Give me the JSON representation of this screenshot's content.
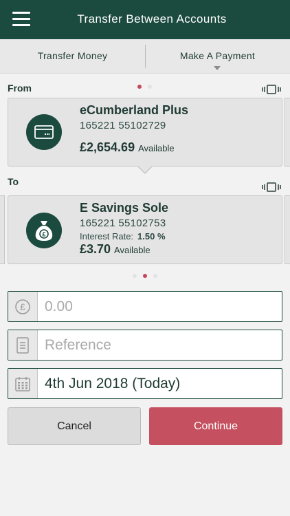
{
  "header": {
    "title": "Transfer Between Accounts",
    "menu_icon": "hamburger-menu-icon"
  },
  "tabs": [
    {
      "label": "Transfer Money"
    },
    {
      "label": "Make A Payment"
    }
  ],
  "from": {
    "label": "From",
    "account": {
      "name": "eCumberland Plus",
      "number": "165221 55102729",
      "balance": "£2,654.69",
      "balance_label": "Available",
      "icon": "credit-card-icon"
    }
  },
  "to": {
    "label": "To",
    "account": {
      "name": "E Savings Sole",
      "number": "165221 55102753",
      "rate_label": "Interest Rate:",
      "rate_value": "1.50 %",
      "balance": "£3.70",
      "balance_label": "Available",
      "icon": "money-bag-icon"
    }
  },
  "form": {
    "amount_placeholder": "0.00",
    "reference_placeholder": "Reference",
    "date_value": "4th Jun 2018 (Today)"
  },
  "buttons": {
    "cancel": "Cancel",
    "continue": "Continue"
  },
  "colors": {
    "brand": "#1b4a3f",
    "accent": "#c5475a",
    "continue_bg": "#c5505f"
  }
}
